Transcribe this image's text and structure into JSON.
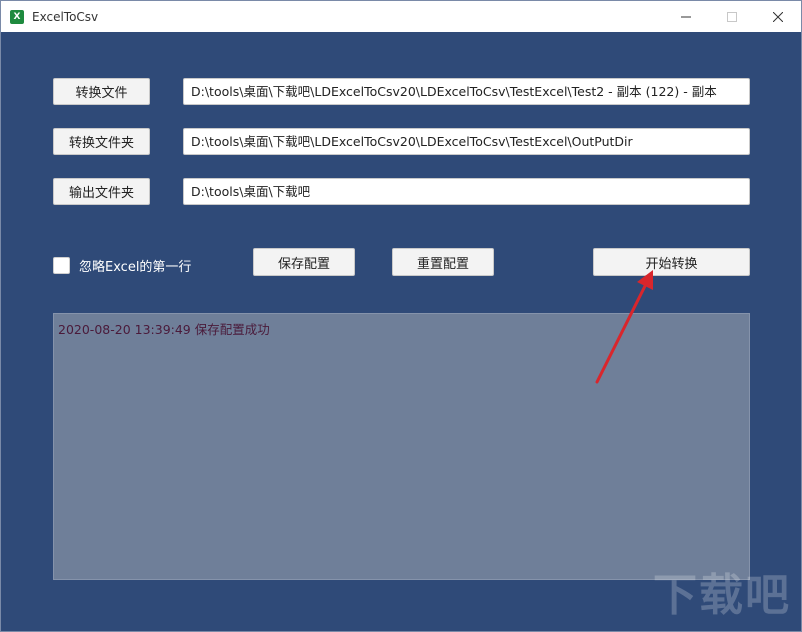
{
  "window": {
    "title": "ExcelToCsv",
    "icon": "excel-icon"
  },
  "rows": {
    "convert_file_button": "转换文件",
    "convert_file_path": "D:\\tools\\桌面\\下载吧\\LDExcelToCsv20\\LDExcelToCsv\\TestExcel\\Test2 - 副本 (122) - 副本",
    "convert_folder_button": "转换文件夹",
    "convert_folder_path": "D:\\tools\\桌面\\下载吧\\LDExcelToCsv20\\LDExcelToCsv\\TestExcel\\OutPutDir",
    "output_folder_button": "输出文件夹",
    "output_folder_path": "D:\\tools\\桌面\\下载吧"
  },
  "options": {
    "ignore_first_row_label": "忽略Excel的第一行",
    "ignore_first_row_checked": false,
    "save_config_button": "保存配置",
    "reset_config_button": "重置配置",
    "start_convert_button": "开始转换"
  },
  "log": {
    "lines": [
      "2020-08-20 13:39:49  保存配置成功"
    ]
  },
  "colors": {
    "background": "#2f4a78",
    "log_background": "#6f7f99",
    "annotation_arrow": "#d9262c"
  },
  "watermark": "下载吧"
}
